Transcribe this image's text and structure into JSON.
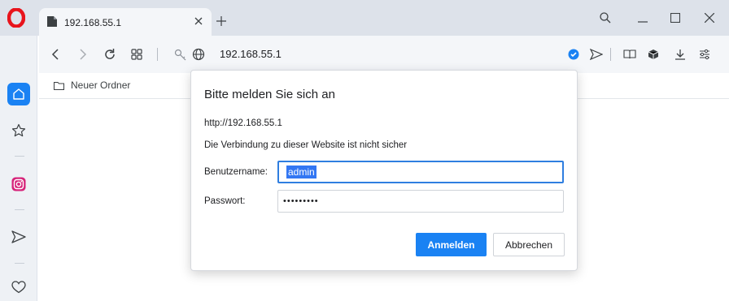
{
  "tab": {
    "title": "192.168.55.1",
    "close_icon": "close-icon",
    "new_tab_icon": "plus-icon"
  },
  "address_bar": {
    "url": "192.168.55.1"
  },
  "bookmarks": {
    "items": [
      {
        "label": "Neuer Ordner",
        "icon": "folder-icon"
      }
    ]
  },
  "sidebar": {
    "items": [
      "home-icon",
      "star-icon",
      "instagram-icon",
      "send-icon",
      "heart-icon"
    ]
  },
  "dialog": {
    "title": "Bitte melden Sie sich an",
    "origin": "http://192.168.55.1",
    "warning": "Die Verbindung zu dieser Website ist nicht sicher",
    "username_label": "Benutzername:",
    "username_value": "admin",
    "password_label": "Passwort:",
    "password_value": "•••••••••",
    "login_label": "Anmelden",
    "cancel_label": "Abbrechen"
  },
  "colors": {
    "accent": "#1a82f3",
    "opera_red": "#e8141c",
    "chrome_bg": "#dde2ea",
    "toolbar_bg": "#f4f6f9"
  }
}
